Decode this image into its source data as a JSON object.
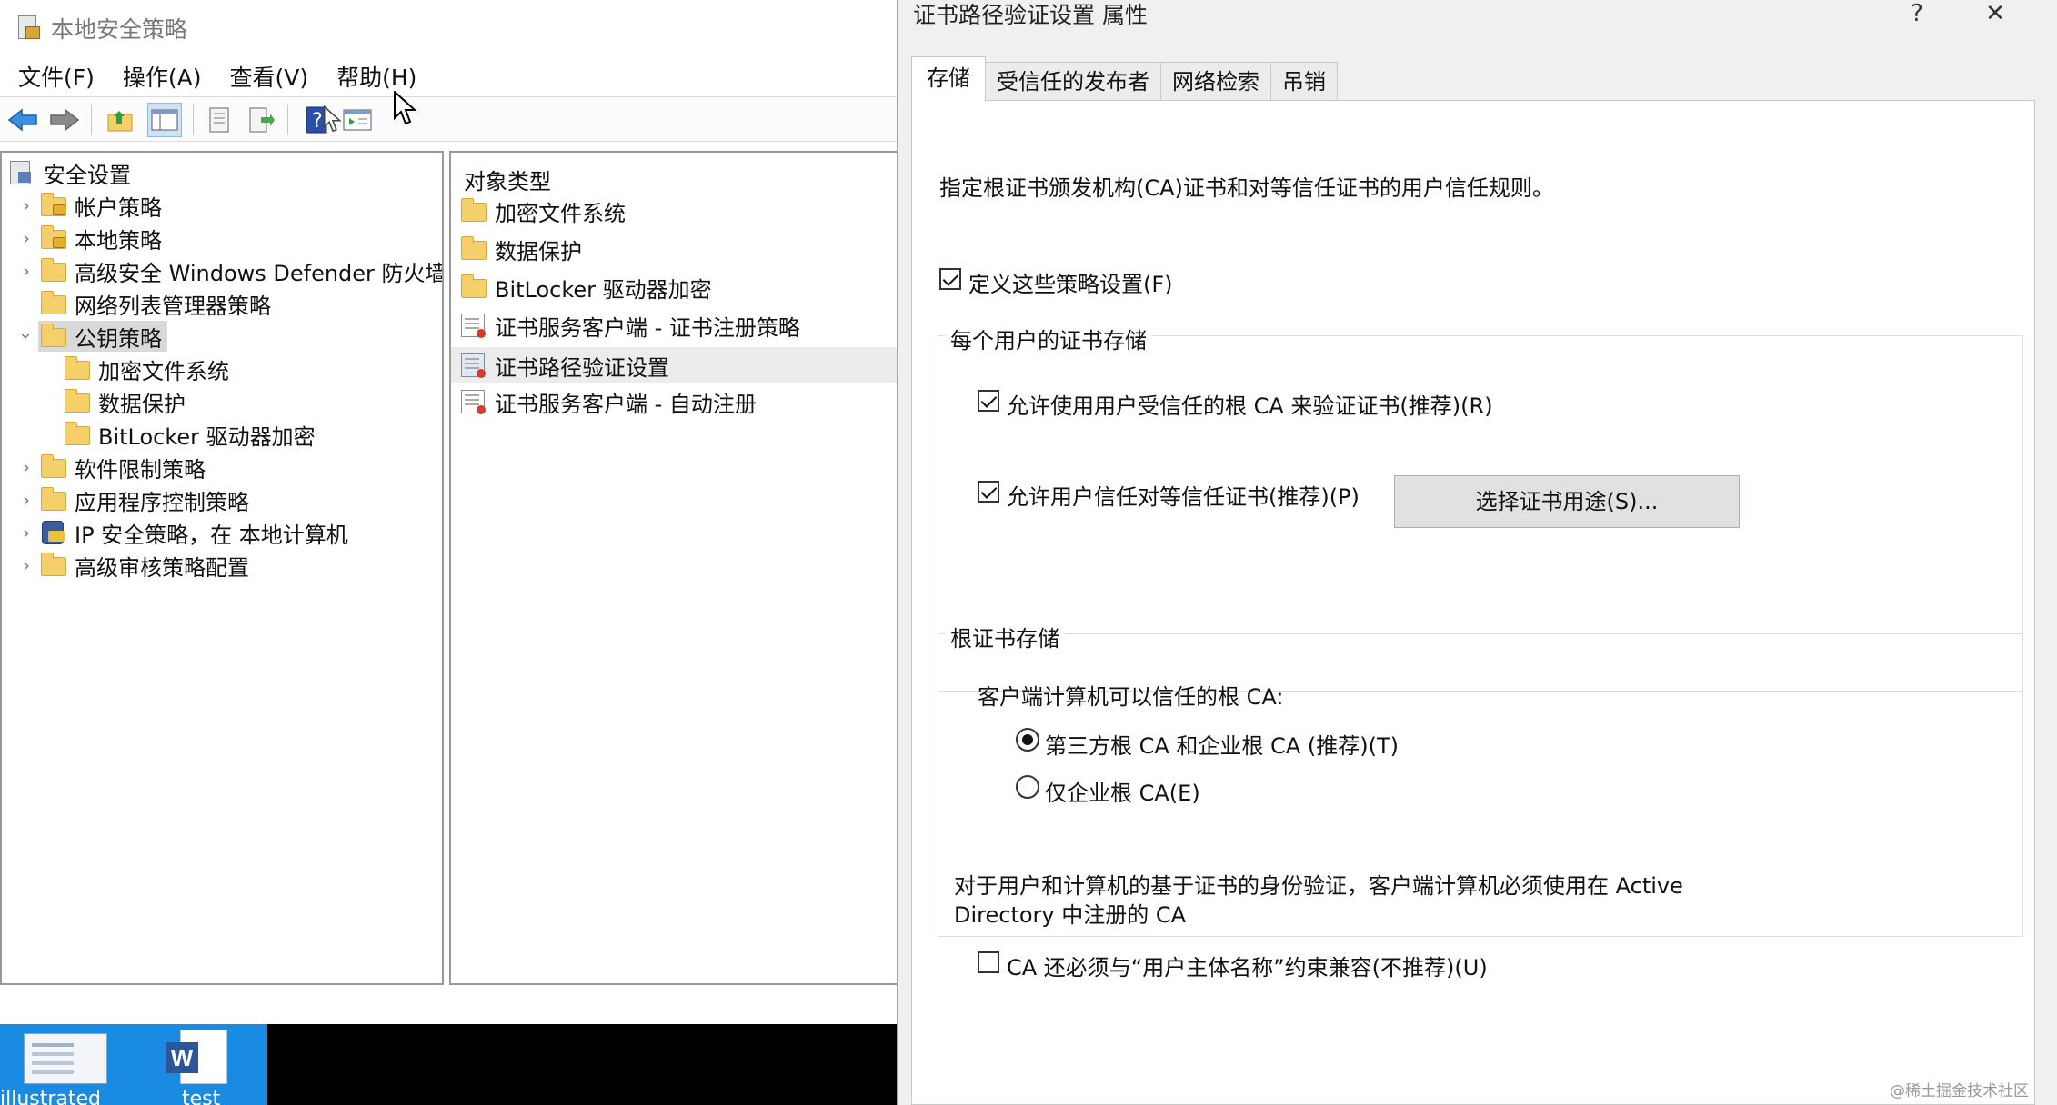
{
  "mmc": {
    "title": "本地安全策略",
    "menus": [
      "文件(F)",
      "操作(A)",
      "查看(V)",
      "帮助(H)"
    ],
    "tree": [
      {
        "label": "安全设置",
        "icon": "security-settings-icon"
      },
      {
        "label": "帐户策略",
        "icon": "folder-lock-icon"
      },
      {
        "label": "本地策略",
        "icon": "folder-lock-icon"
      },
      {
        "label": "高级安全 Windows Defender 防火墙",
        "icon": "folder-icon"
      },
      {
        "label": "网络列表管理器策略",
        "icon": "folder-icon"
      },
      {
        "label": "公钥策略",
        "icon": "folder-icon"
      },
      {
        "label": "加密文件系统",
        "icon": "folder-icon"
      },
      {
        "label": "数据保护",
        "icon": "folder-icon"
      },
      {
        "label": "BitLocker 驱动器加密",
        "icon": "folder-icon"
      },
      {
        "label": "软件限制策略",
        "icon": "folder-icon"
      },
      {
        "label": "应用程序控制策略",
        "icon": "folder-icon"
      },
      {
        "label": "IP 安全策略，在 本地计算机",
        "icon": "ip-security-icon"
      },
      {
        "label": "高级审核策略配置",
        "icon": "folder-icon"
      }
    ],
    "list_header": "对象类型",
    "list": [
      {
        "label": "加密文件系统",
        "icon": "folder-icon"
      },
      {
        "label": "数据保护",
        "icon": "folder-icon"
      },
      {
        "label": "BitLocker 驱动器加密",
        "icon": "folder-icon"
      },
      {
        "label": "证书服务客户端 - 证书注册策略",
        "icon": "certificate-icon"
      },
      {
        "label": "证书路径验证设置",
        "icon": "certificate-icon"
      },
      {
        "label": "证书服务客户端 - 自动注册",
        "icon": "certificate-icon"
      }
    ],
    "taskbar": {
      "items": [
        "illustrated",
        "test"
      ]
    }
  },
  "dialog": {
    "title": "证书路径验证设置 属性",
    "help": "?",
    "close": "✕",
    "tabs": [
      "存储",
      "受信任的发布者",
      "网络检索",
      "吊销"
    ],
    "description": "指定根证书颁发机构(CA)证书和对等信任证书的用户信任规则。",
    "define_policy": {
      "label": "定义这些策略设置(F)",
      "checked": true
    },
    "per_user_group": {
      "title": "每个用户的证书存储",
      "allow_root_ca": {
        "label": "允许使用用户受信任的根 CA 来验证证书(推荐)(R)",
        "checked": true
      },
      "allow_peer": {
        "label": "允许用户信任对等信任证书(推荐)(P)",
        "checked": true
      },
      "select_purpose_button": "选择证书用途(S)..."
    },
    "root_store_group": {
      "title": "根证书存储",
      "prompt": "客户端计算机可以信任的根 CA:",
      "options": [
        {
          "label": "第三方根 CA 和企业根 CA (推荐)(T)",
          "selected": true
        },
        {
          "label": "仅企业根 CA(E)",
          "selected": false
        }
      ]
    },
    "ad_note_line1": "对于用户和计算机的基于证书的身份验证，客户端计算机必须使用在 Active",
    "ad_note_line2": "Directory 中注册的 CA",
    "upn_constraint": {
      "label": "CA 还必须与“用户主体名称”约束兼容(不推荐)(U)",
      "checked": false
    },
    "watermark": "@稀土掘金技术社区"
  }
}
